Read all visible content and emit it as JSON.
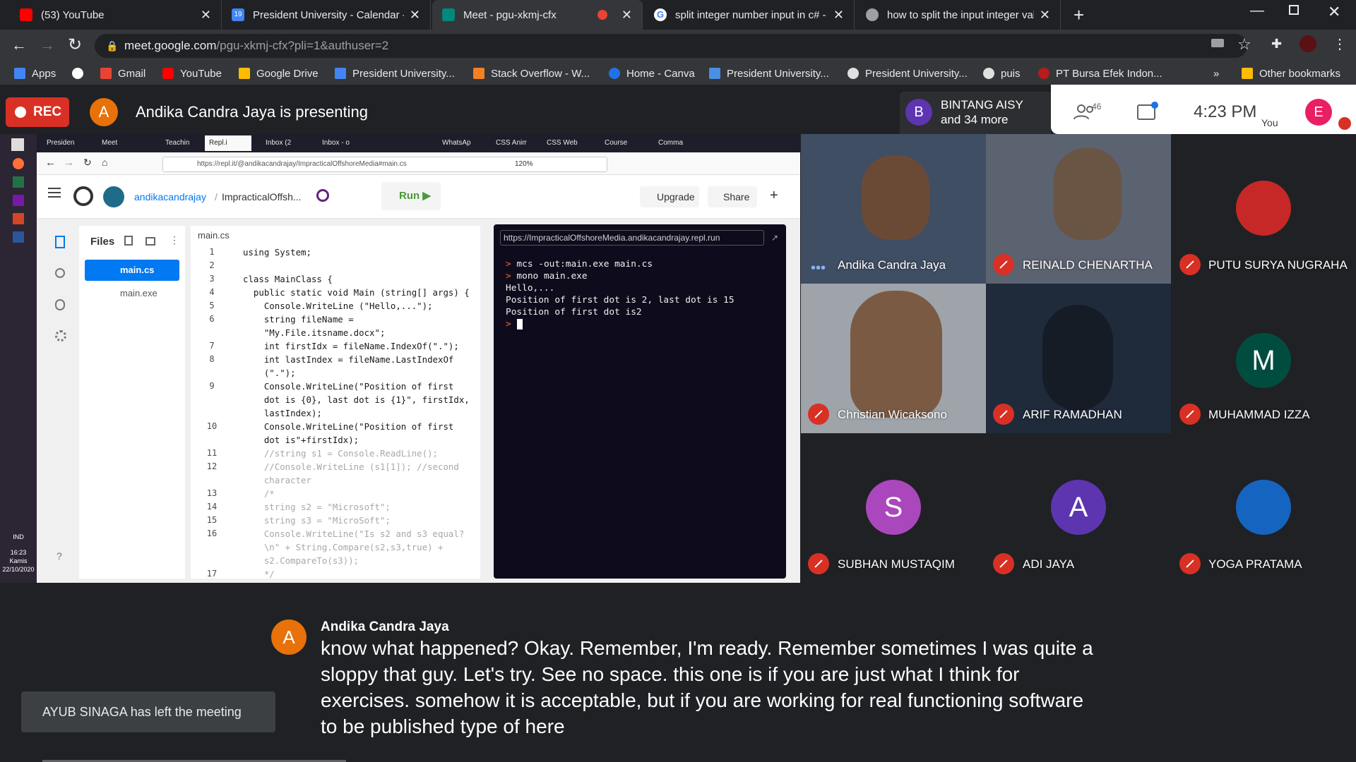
{
  "browser": {
    "tabs": [
      {
        "title": "(53) YouTube",
        "color": "#ff0000"
      },
      {
        "title": "President University - Calendar -",
        "color": "#4285f4"
      },
      {
        "title": "Meet - pgu-xkmj-cfx",
        "color": "#00897b"
      },
      {
        "title": "split integer number input in c# -",
        "color": "#ffffff"
      },
      {
        "title": "how to split the input integer val",
        "color": "#5f6368"
      }
    ],
    "address": {
      "host": "meet.google.com",
      "path": "/pgu-xkmj-cfx?pli=1&authuser=2"
    },
    "bookmarks": [
      "Apps",
      "Gmail",
      "YouTube",
      "Google Drive",
      "President University...",
      "Stack Overflow - W...",
      "Home - Canva",
      "President University...",
      "President University...",
      "puis",
      "PT Bursa Efek Indon...",
      "Other bookmarks"
    ],
    "bookmark_more": "»"
  },
  "meet": {
    "rec_label": "REC",
    "presenter_initial": "A",
    "presenting_text": "Andika Candra Jaya is presenting",
    "participants_summary_initial": "B",
    "participants_summary_line1": "BINTANG AISY",
    "participants_summary_line2": "and 34 more",
    "participants_count": "46",
    "clock": "4:23 PM",
    "self_initial": "E",
    "self_label": "You"
  },
  "shared_screen": {
    "firefox_tabs": [
      "Presiden",
      "Meet",
      "Teachin",
      "Repl.i",
      "Inbox (2",
      "Inbox - o",
      "WhatsAp",
      "CSS Anim",
      "CSS Web",
      "Course",
      "Comma"
    ],
    "firefox_url": "https://repl.it/@andikacandrajay/ImpracticalOffshoreMedia#main.cs",
    "zoom": "120%",
    "repl_user": "andikacandrajay",
    "repl_project": "ImpracticalOffsh...",
    "run_label": "Run",
    "upgrade_label": "Upgrade",
    "share_label": "Share",
    "files_label": "Files",
    "files": [
      "main.cs",
      "main.exe"
    ],
    "editor_tab": "main.cs",
    "code_lines": [
      {
        "ln": "1",
        "text": "using System;"
      },
      {
        "ln": "2",
        "text": ""
      },
      {
        "ln": "3",
        "text": "class MainClass {"
      },
      {
        "ln": "4",
        "text": "  public static void Main (string[] args) {"
      },
      {
        "ln": "5",
        "text": "    Console.WriteLine (\"Hello,...\");"
      },
      {
        "ln": "6",
        "text": "    string fileName ="
      },
      {
        "ln": "",
        "text": "    \"My.File.itsname.docx\";"
      },
      {
        "ln": "7",
        "text": "    int firstIdx = fileName.IndexOf(\".\");"
      },
      {
        "ln": "8",
        "text": "    int lastIndex = fileName.LastIndexOf"
      },
      {
        "ln": "",
        "text": "    (\".\");"
      },
      {
        "ln": "9",
        "text": "    Console.WriteLine(\"Position of first"
      },
      {
        "ln": "",
        "text": "    dot is {0}, last dot is {1}\", firstIdx,"
      },
      {
        "ln": "",
        "text": "    lastIndex);"
      },
      {
        "ln": "10",
        "text": "    Console.WriteLine(\"Position of first"
      },
      {
        "ln": "",
        "text": "    dot is\"+firstIdx);"
      },
      {
        "ln": "11",
        "text": "    //string s1 = Console.ReadLine();"
      },
      {
        "ln": "12",
        "text": "    //Console.WriteLine (s1[1]); //second"
      },
      {
        "ln": "",
        "text": "    character"
      },
      {
        "ln": "13",
        "text": "    /*"
      },
      {
        "ln": "14",
        "text": "    string s2 = \"Microsoft\";"
      },
      {
        "ln": "15",
        "text": "    string s3 = \"MicroSoft\";"
      },
      {
        "ln": "16",
        "text": "    Console.WriteLine(\"Is s2 and s3 equal?"
      },
      {
        "ln": "",
        "text": "    \\n\" + String.Compare(s2,s3,true) +"
      },
      {
        "ln": "",
        "text": "    s2.CompareTo(s3));"
      },
      {
        "ln": "17",
        "text": "    */"
      }
    ],
    "console_url": "https://ImpracticalOffshoreMedia.andikacandrajay.repl.run",
    "console_lines": [
      "> mcs -out:main.exe main.cs",
      "> mono main.exe",
      "Hello,...",
      "Position of first dot is 2, last dot is 15",
      "Position of first dot is2",
      ">"
    ],
    "taskbar_lang": "IND",
    "taskbar_time": "16:23",
    "taskbar_day": "Kamis",
    "taskbar_date": "22/10/2020"
  },
  "participants": [
    {
      "name": "Andika Candra Jaya",
      "initial": "",
      "muted": false
    },
    {
      "name": "REINALD CHENARTHA",
      "initial": "",
      "muted": true
    },
    {
      "name": "PUTU SURYA NUGRAHA",
      "initial": "",
      "muted": true
    },
    {
      "name": "Christian Wicaksono",
      "initial": "",
      "muted": true
    },
    {
      "name": "ARIF RAMADHAN",
      "initial": "",
      "muted": true
    },
    {
      "name": "MUHAMMAD IZZA",
      "initial": "M",
      "muted": true
    },
    {
      "name": "SUBHAN MUSTAQIM",
      "initial": "S",
      "muted": true
    },
    {
      "name": "ADI JAYA",
      "initial": "A",
      "muted": true
    },
    {
      "name": "YOGA PRATAMA",
      "initial": "",
      "muted": true
    }
  ],
  "captions": {
    "speaker_initial": "A",
    "speaker": "Andika Candra Jaya",
    "text": "know what happened? Okay. Remember, I'm ready. Remember sometimes I was quite a sloppy that guy. Let's try. See no space. this one is if you are just what I think for exercises. somehow it is acceptable, but if you are working for real functioning software to be published type of here"
  },
  "toast": "AYUB SINAGA has left the meeting",
  "colors": {
    "accent_orange": "#e8710a",
    "rec_red": "#d93025",
    "repl_blue": "#0079f2",
    "meet_dark": "#202124"
  }
}
